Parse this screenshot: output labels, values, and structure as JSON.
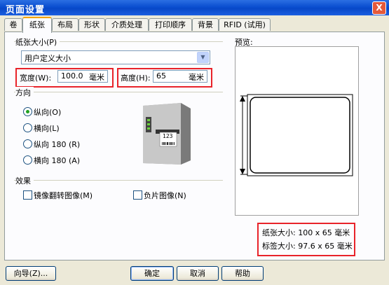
{
  "window": {
    "title": "页面设置",
    "close": "X"
  },
  "tabs": [
    "卷",
    "纸张",
    "布局",
    "形状",
    "介质处理",
    "打印顺序",
    "背景",
    "RFID (试用)"
  ],
  "paper": {
    "group_label": "纸张大小(P)",
    "size_value": "用户定义大小",
    "width_label": "宽度(W):",
    "width_value": "100.0",
    "width_unit": "毫米",
    "height_label": "高度(H):",
    "height_value": "65",
    "height_unit": "毫米"
  },
  "orientation": {
    "group_label": "方向",
    "options": [
      "纵向(O)",
      "横向(L)",
      "纵向 180 (R)",
      "横向 180 (A)"
    ],
    "selected_index": 0
  },
  "printer_label_text": "123",
  "effects": {
    "group_label": "效果",
    "mirror": "镜像翻转图像(M)",
    "negative": "负片图像(N)"
  },
  "preview": {
    "label": "预览:",
    "paper_size": "纸张大小: 100 x 65  毫米",
    "label_size": "标签大小: 97.6 x 65  毫米"
  },
  "buttons": {
    "wizard": "向导(Z)...",
    "ok": "确定",
    "cancel": "取消",
    "help": "帮助"
  },
  "colors": {
    "title_bar": "#0a4ed0",
    "highlight_box": "#e8232a",
    "dialog_bg": "#ece9d8"
  }
}
